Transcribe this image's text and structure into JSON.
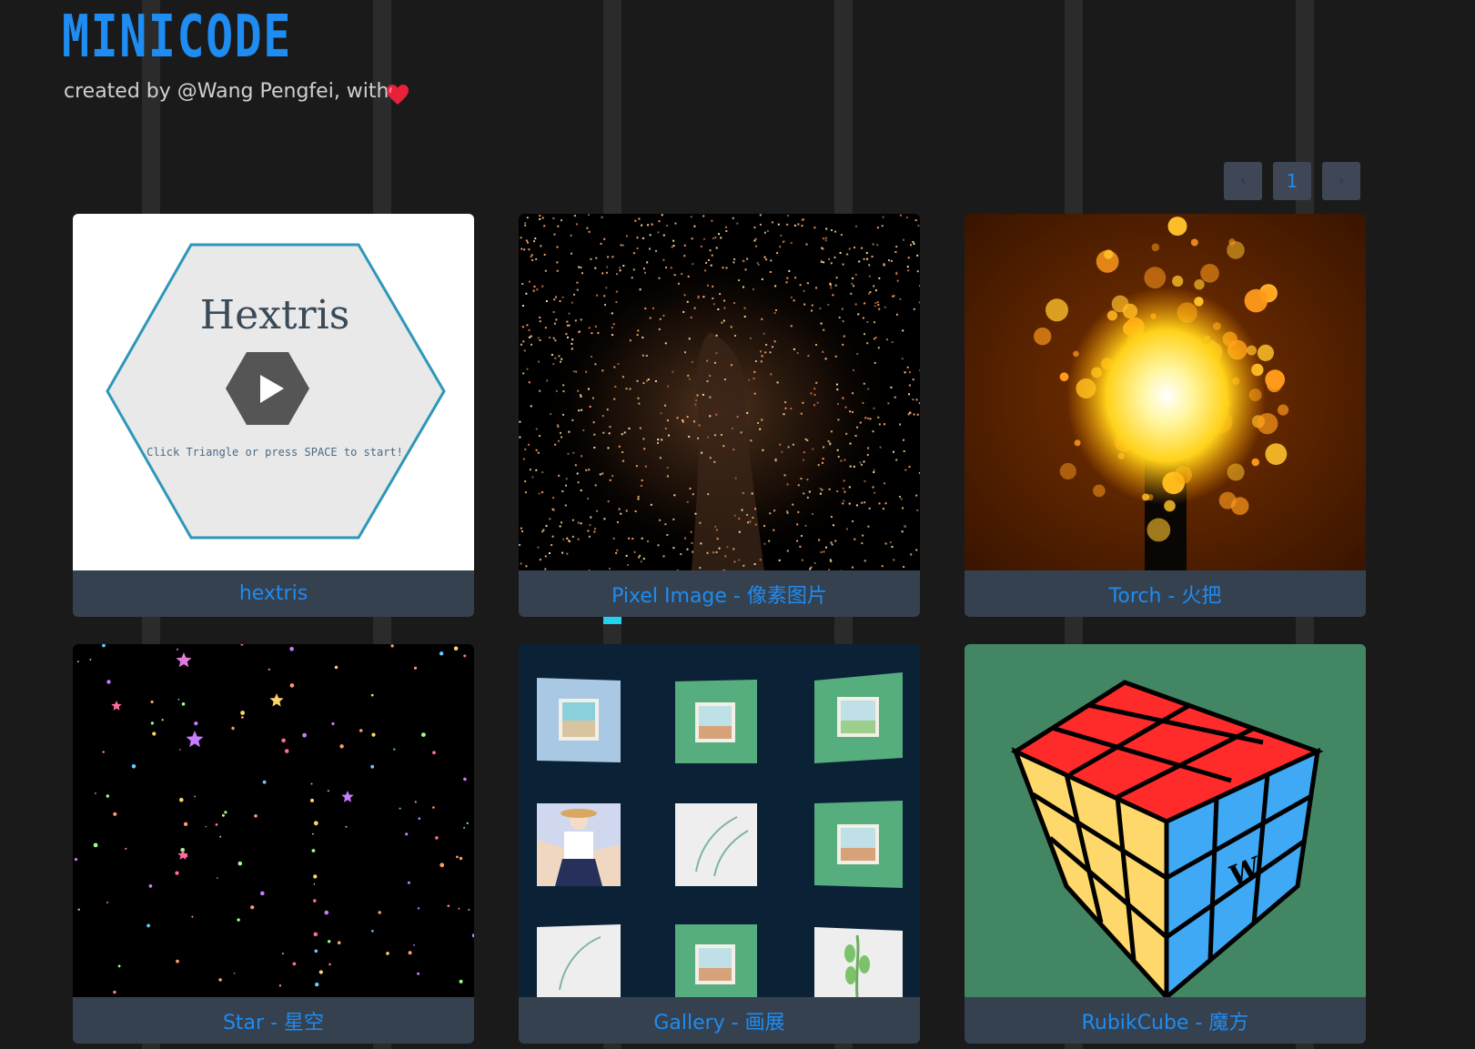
{
  "header": {
    "logo": "MINICODE",
    "subtitle": "created by @Wang Pengfei, with",
    "heart_icon": "heart-icon"
  },
  "pagination": {
    "prev": "‹",
    "current": "1",
    "next": "›"
  },
  "cards": [
    {
      "label": "hextris",
      "thumb_title": "Hextris",
      "thumb_hint": "Click Triangle or press SPACE to start!"
    },
    {
      "label": "Pixel Image - 像素图片"
    },
    {
      "label": "Torch - 火把"
    },
    {
      "label": "Star - 星空"
    },
    {
      "label": "Gallery - 画展"
    },
    {
      "label": "RubikCube - 魔方"
    }
  ],
  "colors": {
    "background": "#1a1a1a",
    "accent": "#1e8cf0",
    "card_label_bg": "#364150"
  }
}
